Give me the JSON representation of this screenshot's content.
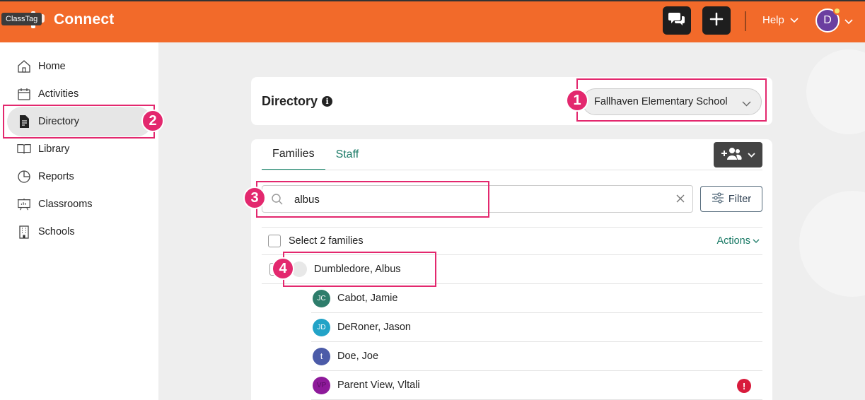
{
  "header": {
    "tooltip": "ClassTag",
    "app_name": "Connect",
    "help_label": "Help",
    "avatar_initial": "D",
    "brand_color": "#f26a2a"
  },
  "sidebar": {
    "items": [
      {
        "label": "Home",
        "icon": "home-icon"
      },
      {
        "label": "Activities",
        "icon": "calendar-icon"
      },
      {
        "label": "Directory",
        "icon": "document-icon",
        "active": true
      },
      {
        "label": "Library",
        "icon": "book-icon"
      },
      {
        "label": "Reports",
        "icon": "pie-chart-icon"
      },
      {
        "label": "Classrooms",
        "icon": "presentation-icon"
      },
      {
        "label": "Schools",
        "icon": "building-icon"
      }
    ]
  },
  "directory": {
    "title": "Directory",
    "school": "Fallhaven Elementary School"
  },
  "tabs": [
    "Families",
    "Staff"
  ],
  "search": {
    "value": "albus"
  },
  "filter_label": "Filter",
  "select_label": "Select 2 families",
  "actions_label": "Actions",
  "family": {
    "name": "Dumbledore, Albus"
  },
  "members": [
    {
      "initials": "JC",
      "name": "Cabot, Jamie",
      "color": "#2e7d6b"
    },
    {
      "initials": "JD",
      "name": "DeRoner, Jason",
      "color": "#22a3c7"
    },
    {
      "initials": "t",
      "name": "Doe, Joe",
      "color": "#4b5ba8"
    },
    {
      "initials": "VP",
      "name": "Parent View, Vltali",
      "color": "#8e1a9a",
      "alert": "!"
    }
  ],
  "annotations": [
    "1",
    "2",
    "3",
    "4"
  ]
}
